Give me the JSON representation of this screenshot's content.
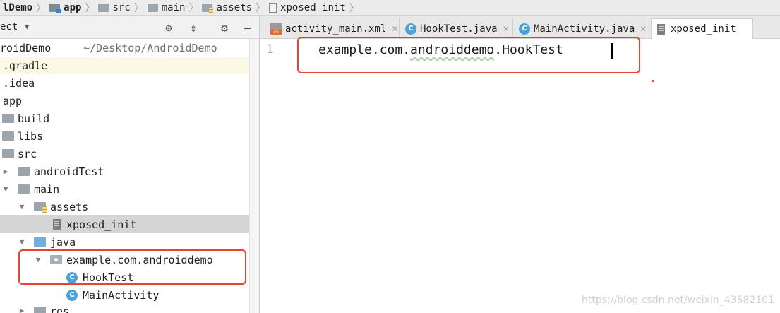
{
  "breadcrumb": {
    "items": [
      "lDemo",
      "app",
      "src",
      "main",
      "assets",
      "xposed_init"
    ]
  },
  "project_panel": {
    "selector_label": "ect",
    "tools": [
      "crosshair-icon",
      "collapse-icon",
      "gear-icon",
      "minimize-icon"
    ],
    "tree": [
      {
        "label": "roidDemo",
        "extra": "~/Desktop/AndroidDemo"
      },
      {
        "label": ".gradle"
      },
      {
        "label": ".idea"
      },
      {
        "label": "app"
      },
      {
        "label": "build"
      },
      {
        "label": "libs"
      },
      {
        "label": "src"
      },
      {
        "label": "androidTest"
      },
      {
        "label": "main"
      },
      {
        "label": "assets"
      },
      {
        "label": "xposed_init"
      },
      {
        "label": "java"
      },
      {
        "label": "example.com.androiddemo"
      },
      {
        "label": "HookTest"
      },
      {
        "label": "MainActivity"
      },
      {
        "label": "res"
      }
    ]
  },
  "editor": {
    "tabs": [
      {
        "label": "activity_main.xml",
        "icon": "xml-file-icon"
      },
      {
        "label": "HookTest.java",
        "icon": "class-icon"
      },
      {
        "label": "MainActivity.java",
        "icon": "class-icon"
      },
      {
        "label": "xposed_init",
        "icon": "text-file-icon"
      }
    ],
    "line_number": "1",
    "code_line": "example.com.androiddemo.HookTest",
    "code_prefix": "example.com.",
    "code_squiggle": "androiddemo",
    "code_suffix": ".HookTest"
  },
  "close_glyph": "×",
  "class_glyph": "C",
  "colors": {
    "annotation": "#e8432b",
    "class_icon": "#4aa3d8",
    "highlight_row": "#fbf9e3",
    "selected_row": "#d5d5d5"
  },
  "watermark": "https://blog.csdn.net/weixin_43582101"
}
